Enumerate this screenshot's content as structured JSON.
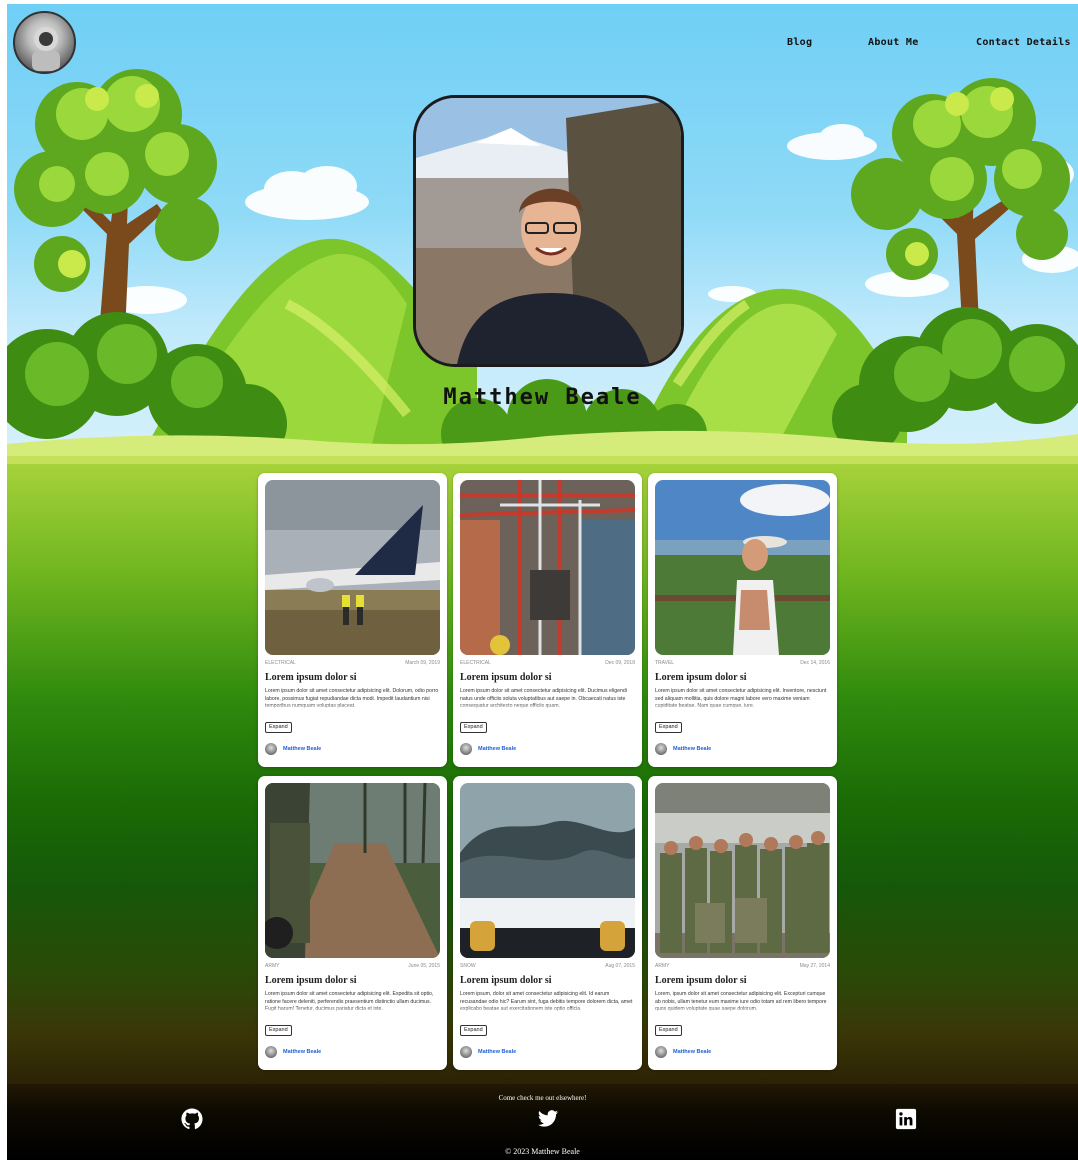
{
  "nav": {
    "items": [
      "Blog",
      "About Me",
      "Contact Details"
    ]
  },
  "hero": {
    "name": "Matthew Beale"
  },
  "posts": [
    {
      "category": "ELECTRICAL",
      "date": "March 09, 2019",
      "title": "Lorem ipsum dolor si",
      "excerpt": "Lorem ipsum dolor sit amet consectetur adipisicing elit. Dolorum, odio porro labore, possimus fugiat repudiandae dicta modi. Impedit laudantium nisi temporibus numquam voluptas placeat.",
      "expand_label": "Expand",
      "author": "Matthew Beale"
    },
    {
      "category": "ELECTRICAL",
      "date": "Dec 09, 2018",
      "title": "Lorem ipsum dolor si",
      "excerpt": "Lorem ipsum dolor sit amet consectetur adipisicing elit. Ducimus eligendi natus unde officiis soluta voluptatibus aut saepe in. Obcaecati natus iste consequatur architecto neque officiis quam.",
      "expand_label": "Expand",
      "author": "Matthew Beale"
    },
    {
      "category": "TRAVEL",
      "date": "Dec 14, 2016",
      "title": "Lorem ipsum dolor si",
      "excerpt": "Lorem ipsum dolor sit amet consectetur adipisicing elit. Inventore, nesciunt sed aliquam mollitia, quis dolore magni labore vero maxime veniam cupiditate beatae. Nam quae cumque, iure.",
      "expand_label": "Expand",
      "author": "Matthew Beale"
    },
    {
      "category": "ARMY",
      "date": "June 05, 2015",
      "title": "Lorem ipsum dolor si",
      "excerpt": "Lorem ipsum dolor sit amet consectetur adipisicing elit. Expedita sit optio, ratione facere deleniti, perferendis praesentium distinctio ullam ducimus. Fugit harum! Tenetur, ducimus pariatur dicta et iste.",
      "expand_label": "Expand",
      "author": "Matthew Beale"
    },
    {
      "category": "SNOW",
      "date": "Aug 07, 2015",
      "title": "Lorem ipsum dolor si",
      "excerpt": "Lorem ipsum, dolor sit amet consectetur adipisicing elit. Id earum recusandae odio hic? Earum sint, fuga debitis tempore dolorem dicta, amet explicabo beatae aut exercitationem iste optio officia.",
      "expand_label": "Expand",
      "author": "Matthew Beale"
    },
    {
      "category": "ARMY",
      "date": "May 27, 2014",
      "title": "Lorem ipsum dolor si",
      "excerpt": "Lorem, ipsum dolor sit amet consectetur adipisicing elit. Excepturi cumque ab nobis, ullam tenetur eum maxime iure odio totam ad rem libero tempore quos quidem voluptate quae saepe dolorum.",
      "expand_label": "Expand",
      "author": "Matthew Beale"
    }
  ],
  "footer": {
    "tagline": "Come check me out elsewhere!",
    "copyright": "© 2023 Matthew Beale"
  },
  "social": [
    "github-icon",
    "twitter-icon",
    "linkedin-icon"
  ],
  "colors": {
    "sky": "#6fcff5",
    "grass": "#7cc52a",
    "dark_green": "#16580a",
    "link": "#1f5fd6",
    "footer": "#000000"
  }
}
